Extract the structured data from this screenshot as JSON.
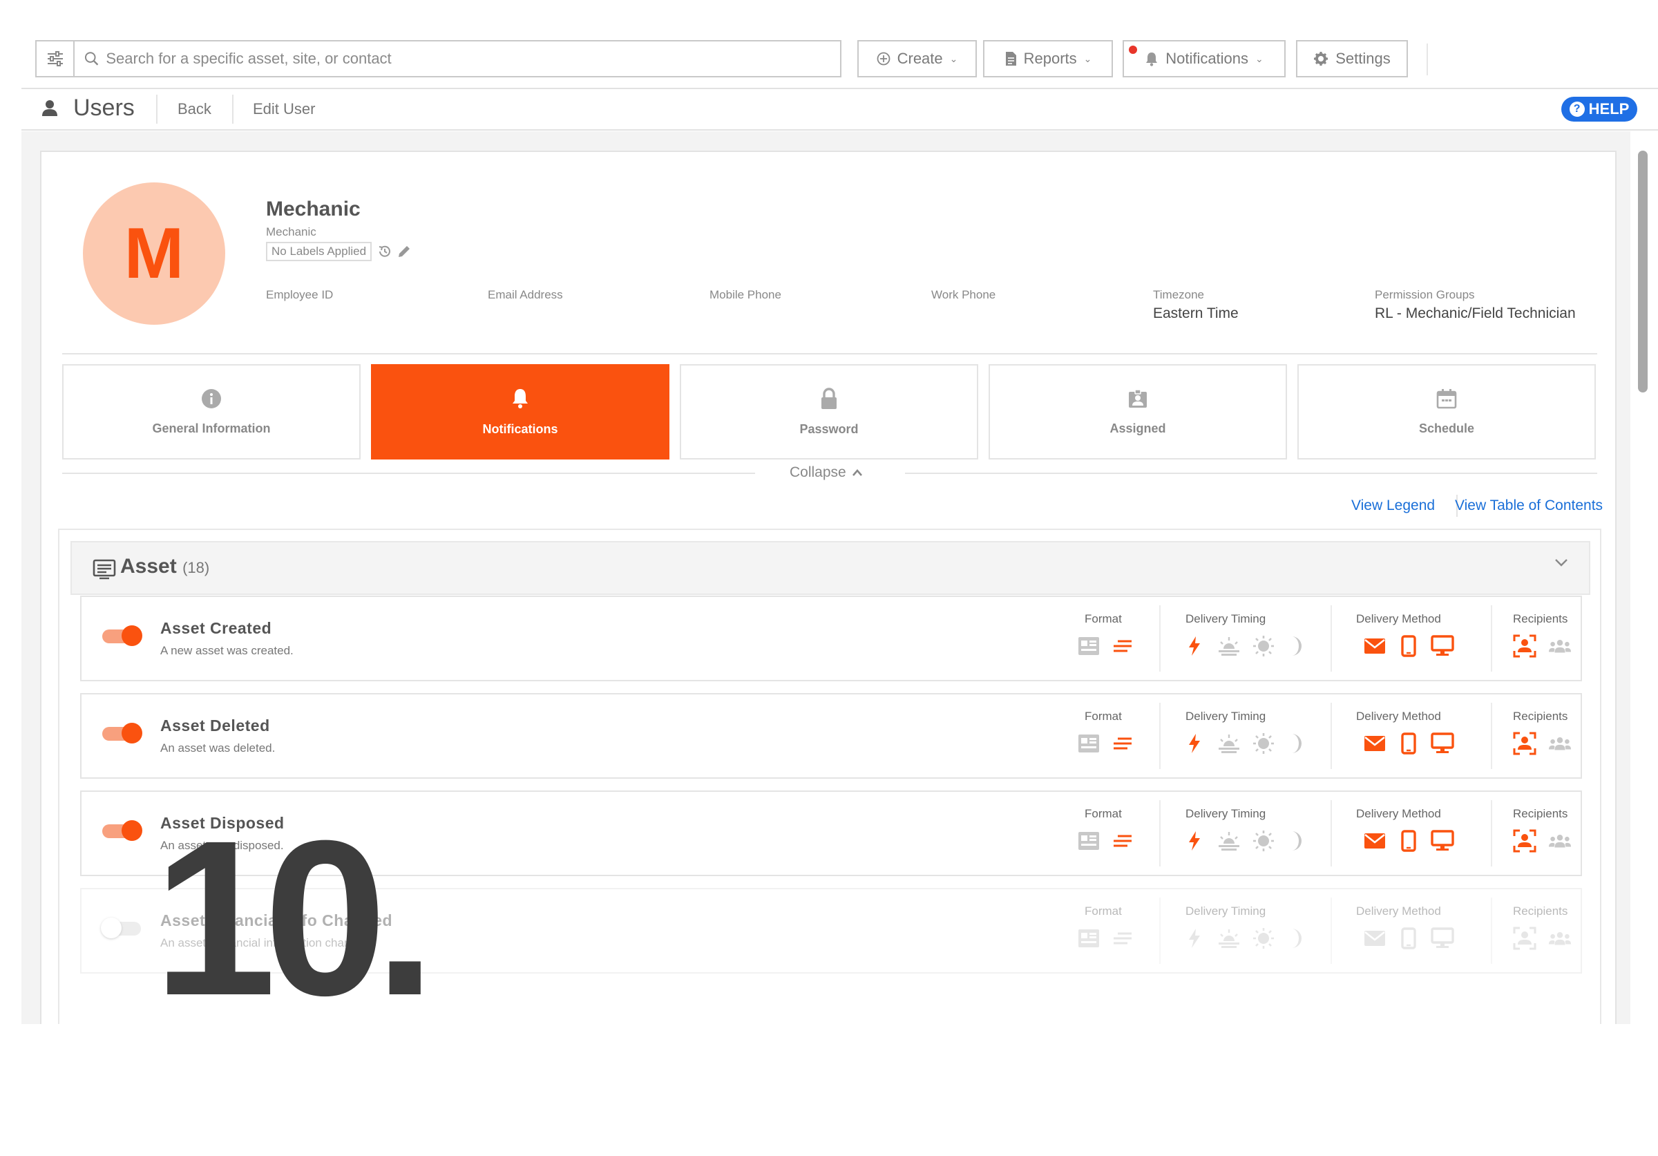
{
  "toolbar": {
    "search_placeholder": "Search for a specific asset, site, or contact",
    "create_label": "Create",
    "reports_label": "Reports",
    "notifications_label": "Notifications",
    "settings_label": "Settings"
  },
  "subheader": {
    "title": "Users",
    "back_label": "Back",
    "edit_label": "Edit User",
    "help_label": "HELP"
  },
  "profile": {
    "avatar_letter": "M",
    "name": "Mechanic",
    "role": "Mechanic",
    "labels_text": "No Labels Applied",
    "fields": [
      {
        "label": "Employee ID",
        "value": ""
      },
      {
        "label": "Email Address",
        "value": ""
      },
      {
        "label": "Mobile Phone",
        "value": ""
      },
      {
        "label": "Work Phone",
        "value": ""
      },
      {
        "label": "Timezone",
        "value": "Eastern Time"
      },
      {
        "label": "Permission Groups",
        "value": "RL - Mechanic/Field Technician"
      }
    ]
  },
  "tabs": [
    {
      "label": "General Information",
      "icon": "info-icon"
    },
    {
      "label": "Notifications",
      "icon": "bell-icon",
      "active": true
    },
    {
      "label": "Password",
      "icon": "lock-icon"
    },
    {
      "label": "Assigned",
      "icon": "badge-icon"
    },
    {
      "label": "Schedule",
      "icon": "calendar-icon"
    }
  ],
  "collapse_label": "Collapse",
  "links": {
    "legend": "View Legend",
    "toc": "View Table of Contents"
  },
  "section": {
    "title": "Asset",
    "count": "(18)"
  },
  "group_labels": {
    "format": "Format",
    "timing": "Delivery Timing",
    "method": "Delivery Method",
    "recipients": "Recipients"
  },
  "rows": [
    {
      "title": "Asset Created",
      "desc": "A new asset was created.",
      "enabled": true
    },
    {
      "title": "Asset Deleted",
      "desc": "An asset was deleted.",
      "enabled": true
    },
    {
      "title": "Asset Disposed",
      "desc": "An asset was disposed.",
      "enabled": true
    },
    {
      "title": "Asset Financial Info Changed",
      "desc": "An asset's financial information changed.",
      "enabled": false
    }
  ],
  "overlay_number": "10.",
  "colors": {
    "accent": "#fa520f",
    "accent_light": "#fcc9b0",
    "link": "#1a6fd8",
    "help": "#1f6fe5",
    "inactive_icon": "#c8c8c8"
  }
}
